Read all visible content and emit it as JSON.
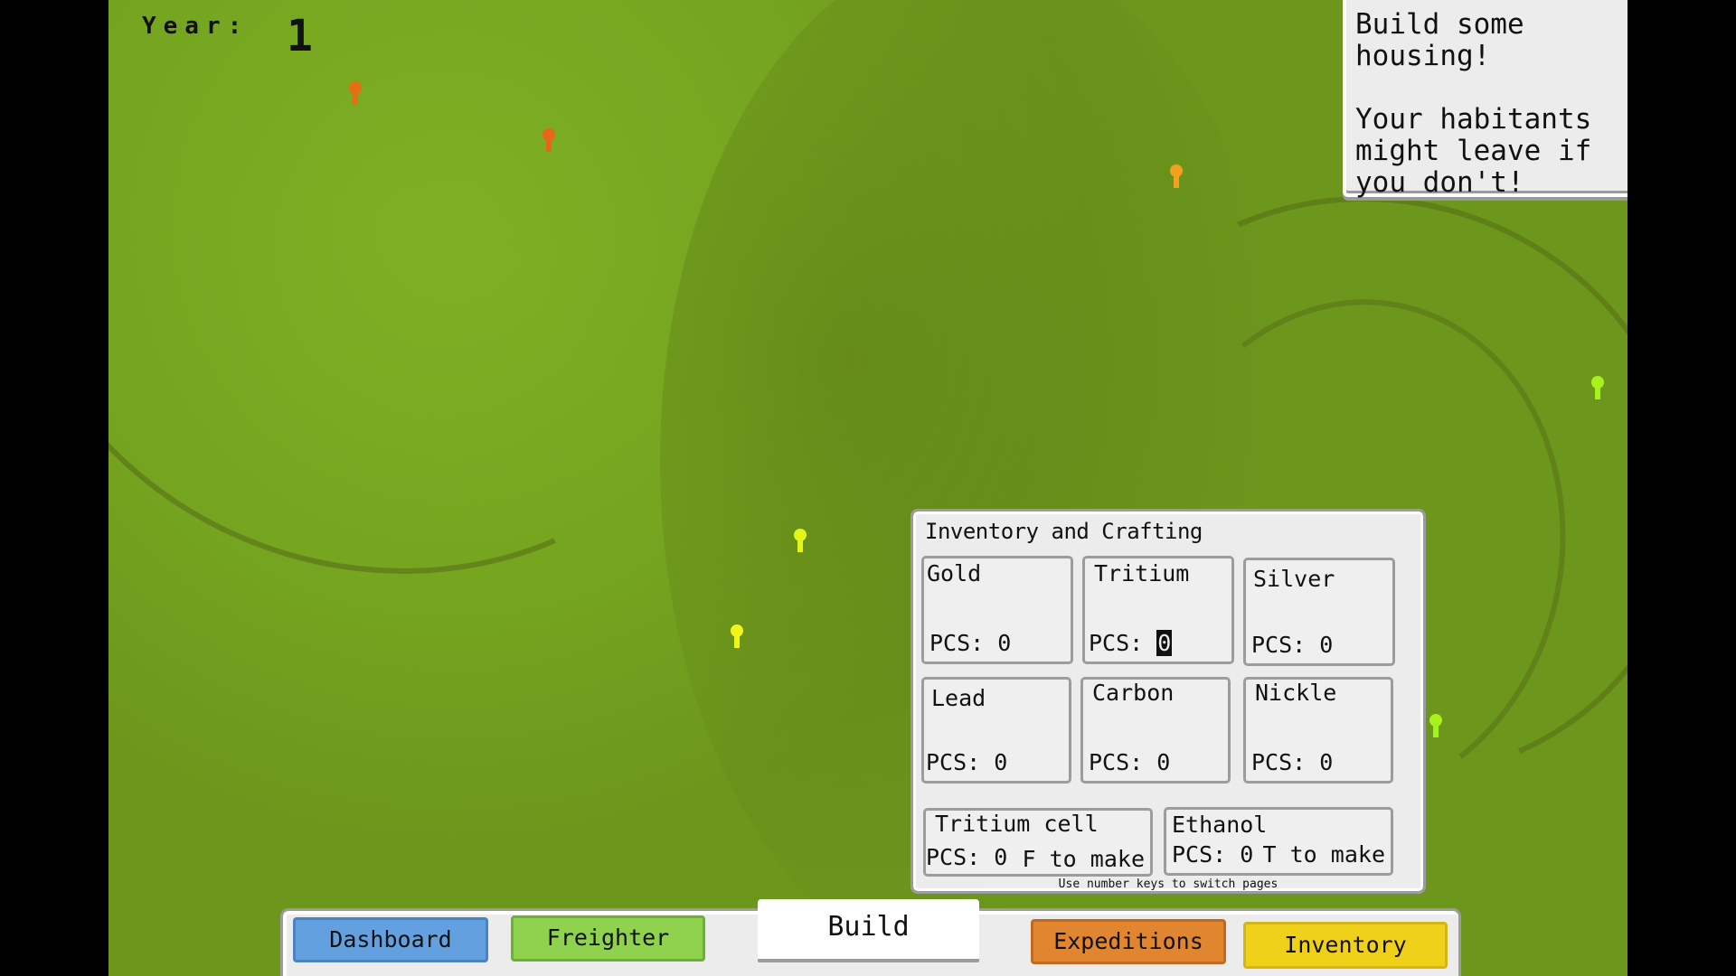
{
  "hud": {
    "year_label": "Year:",
    "year_value": "1"
  },
  "notification": {
    "headline": "Build some housing!",
    "body": "Your habitants might leave if you don't!"
  },
  "inventory_panel": {
    "title": "Inventory and Crafting",
    "resources": [
      {
        "name": "Gold",
        "pcs_label": "PCS:",
        "count": "0"
      },
      {
        "name": "Tritium",
        "pcs_label": "PCS:",
        "count": "0",
        "selected": true
      },
      {
        "name": "Silver",
        "pcs_label": "PCS:",
        "count": "0"
      },
      {
        "name": "Lead",
        "pcs_label": "PCS:",
        "count": "0"
      },
      {
        "name": "Carbon",
        "pcs_label": "PCS:",
        "count": "0"
      },
      {
        "name": "Nickle",
        "pcs_label": "PCS:",
        "count": "0"
      }
    ],
    "crafted": [
      {
        "name": "Tritium cell",
        "pcs_label": "PCS:",
        "count": "0",
        "make_hint": "F to make"
      },
      {
        "name": "Ethanol",
        "pcs_label": "PCS:",
        "count": "0",
        "make_hint": "T to make"
      }
    ],
    "footer_hint": "Use number keys to switch pages"
  },
  "toolbar": {
    "dashboard": "Dashboard",
    "freighter": "Freighter",
    "build": "Build",
    "expeditions": "Expeditions",
    "inventory": "Inventory"
  },
  "map": {
    "markers": [
      {
        "type": "orange-pin",
        "color": "#e86e12"
      },
      {
        "type": "orange-pin",
        "color": "#e8651a"
      },
      {
        "type": "amber-pin",
        "color": "#f2a11f"
      },
      {
        "type": "yellow-pin",
        "color": "#e4f51a"
      },
      {
        "type": "yellow-pin",
        "color": "#f2f51a"
      },
      {
        "type": "lime-pin",
        "color": "#a6f21a"
      },
      {
        "type": "lime-pin",
        "color": "#a6f21a"
      }
    ]
  },
  "colors": {
    "terrain": "#76a620",
    "dashboard": "#63a0e0",
    "freighter": "#8fd24e",
    "expeditions": "#e08530",
    "inventory": "#f0d11a",
    "panel": "#ececec"
  }
}
